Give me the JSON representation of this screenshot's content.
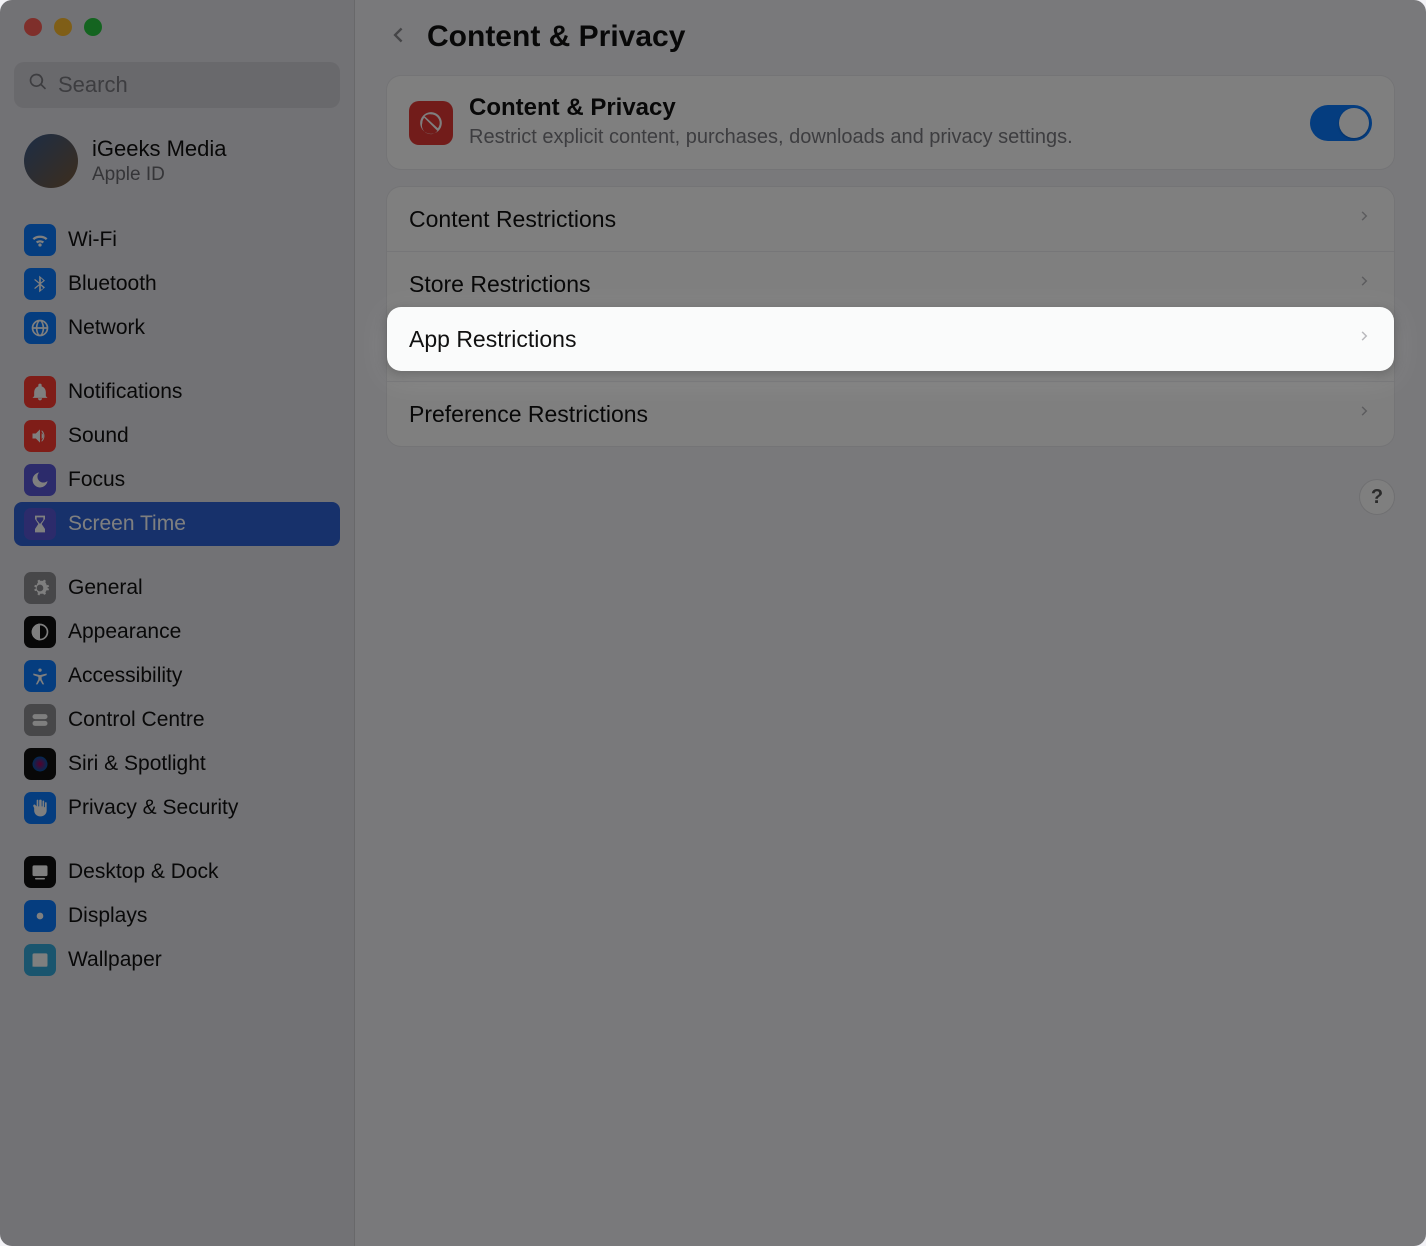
{
  "search": {
    "placeholder": "Search"
  },
  "account": {
    "name": "iGeeks Media",
    "sub": "Apple ID"
  },
  "sidebar": {
    "groups": [
      [
        {
          "label": "Wi-Fi",
          "icon": "wifi",
          "color": "#0a7aff"
        },
        {
          "label": "Bluetooth",
          "icon": "bluetooth",
          "color": "#0a7aff"
        },
        {
          "label": "Network",
          "icon": "globe",
          "color": "#0a7aff"
        }
      ],
      [
        {
          "label": "Notifications",
          "icon": "bell",
          "color": "#ff3b30"
        },
        {
          "label": "Sound",
          "icon": "sound",
          "color": "#ff3b30"
        },
        {
          "label": "Focus",
          "icon": "moon",
          "color": "#5856d6"
        },
        {
          "label": "Screen Time",
          "icon": "hourglass",
          "color": "#5856d6",
          "selected": true
        }
      ],
      [
        {
          "label": "General",
          "icon": "gear",
          "color": "#8e8e93"
        },
        {
          "label": "Appearance",
          "icon": "appearance",
          "color": "#111111"
        },
        {
          "label": "Accessibility",
          "icon": "accessibility",
          "color": "#0a7aff"
        },
        {
          "label": "Control Centre",
          "icon": "switches",
          "color": "#8e8e93"
        },
        {
          "label": "Siri & Spotlight",
          "icon": "siri",
          "color": "#111111"
        },
        {
          "label": "Privacy & Security",
          "icon": "hand",
          "color": "#0a7aff"
        }
      ],
      [
        {
          "label": "Desktop & Dock",
          "icon": "dock",
          "color": "#111111"
        },
        {
          "label": "Displays",
          "icon": "displays",
          "color": "#0a7aff"
        },
        {
          "label": "Wallpaper",
          "icon": "wallpaper",
          "color": "#34aadc"
        }
      ]
    ]
  },
  "header": {
    "title": "Content & Privacy"
  },
  "hero": {
    "title": "Content & Privacy",
    "sub": "Restrict explicit content, purchases, downloads and privacy settings.",
    "toggle_on": true
  },
  "rows": {
    "content": "Content Restrictions",
    "store": "Store Restrictions",
    "app": "App Restrictions",
    "preference": "Preference Restrictions"
  },
  "help": "?"
}
